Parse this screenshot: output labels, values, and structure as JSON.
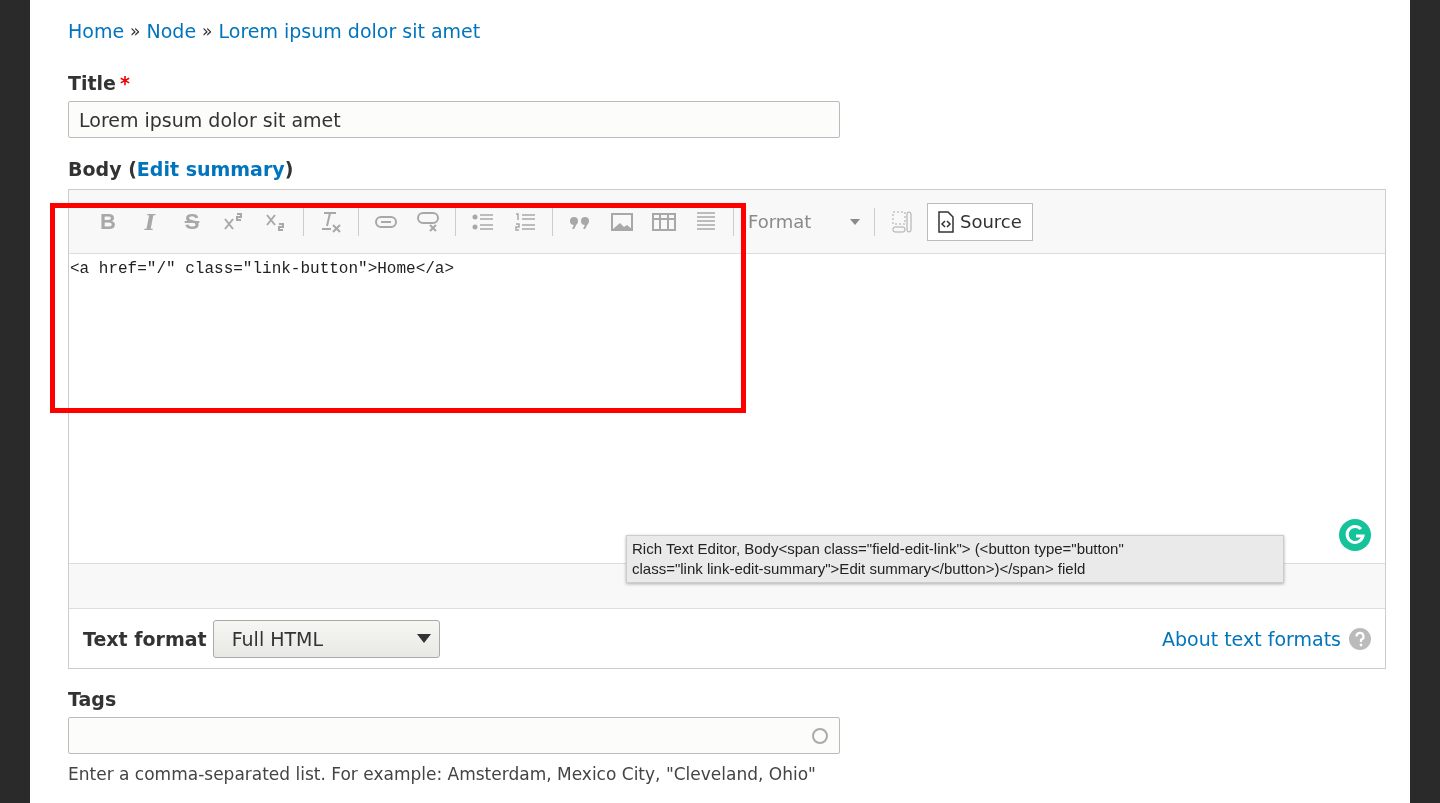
{
  "breadcrumb": [
    "Home",
    "Node",
    "Lorem ipsum dolor sit amet"
  ],
  "breadcrumb_separator": "»",
  "title_field": {
    "label": "Title",
    "required_mark": "*",
    "value": "Lorem ipsum dolor sit amet"
  },
  "body": {
    "label": "Body",
    "link_open": "(",
    "link": "Edit summary",
    "link_close": ")",
    "toolbar": [
      {
        "kind": "bold",
        "glyph": "B",
        "disabled": true
      },
      {
        "kind": "italic",
        "glyph": "I",
        "disabled": true
      },
      {
        "kind": "strike",
        "glyph": "S",
        "disabled": true
      },
      {
        "kind": "superscript",
        "disabled": true
      },
      {
        "kind": "subscript",
        "disabled": true
      },
      {
        "kind": "separator"
      },
      {
        "kind": "remove-format",
        "disabled": true
      },
      {
        "kind": "separator"
      },
      {
        "kind": "link",
        "disabled": true
      },
      {
        "kind": "unlink",
        "disabled": true
      },
      {
        "kind": "separator"
      },
      {
        "kind": "bullet-list",
        "disabled": true
      },
      {
        "kind": "numbered-list",
        "disabled": true
      },
      {
        "kind": "separator"
      },
      {
        "kind": "blockquote",
        "disabled": true
      },
      {
        "kind": "image",
        "disabled": true
      },
      {
        "kind": "table",
        "disabled": true
      },
      {
        "kind": "rule",
        "disabled": true
      },
      {
        "kind": "separator"
      },
      {
        "kind": "format",
        "label": "Format",
        "disabled": true
      },
      {
        "kind": "separator"
      },
      {
        "kind": "show-blocks",
        "disabled": true
      },
      {
        "kind": "source",
        "label": "Source",
        "disabled": false
      }
    ],
    "source_text": "<a href=\"/\" class=\"link-button\">Home</a>",
    "tooltip": [
      "Rich Text Editor, Body<span class=\"field-edit-link\"> (<button type=\"button\"",
      "class=\"link link-edit-summary\">Edit summary</button>)</span> field"
    ],
    "text_format": {
      "label": "Text format",
      "value": "Full HTML",
      "help_link": "About text formats"
    }
  },
  "tags": {
    "label": "Tags",
    "description": "Enter a comma-separated list. For example: Amsterdam, Mexico City, \"Cleveland, Ohio\""
  },
  "annotation": {
    "kind": "rectangle",
    "color": "#ff0000"
  }
}
